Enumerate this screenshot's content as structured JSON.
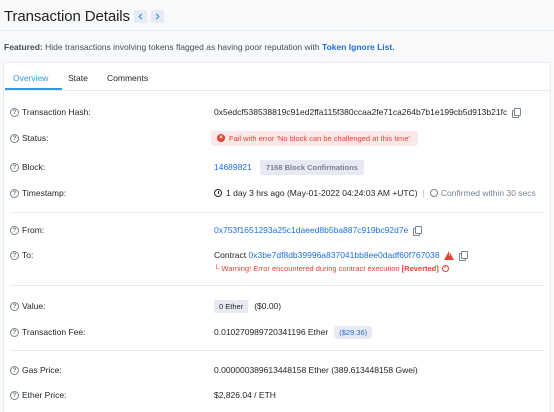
{
  "header": {
    "title": "Transaction Details",
    "prev_icon": "chevron-left-icon",
    "next_icon": "chevron-right-icon"
  },
  "featured": {
    "label": "Featured:",
    "text": "Hide transactions involving tokens flagged as having poor reputation with",
    "link": "Token Ignore List."
  },
  "tabs": [
    "Overview",
    "State",
    "Comments"
  ],
  "details": {
    "tx_hash": {
      "label": "Transaction Hash:",
      "value": "0x5edcf538538819c91ed2ffa115f380ccaa2fe71ca264b7b1e199cb5d913b21fc"
    },
    "status": {
      "label": "Status:",
      "value": "Fail with error 'No block can be challenged at this time'"
    },
    "block": {
      "label": "Block:",
      "value": "14689821",
      "confirmations": "7168 Block Confirmations"
    },
    "timestamp": {
      "label": "Timestamp:",
      "value": "1 day 3 hrs ago (May-01-2022 04:24:03 AM +UTC)",
      "separator": "|",
      "confirmed": "Confirmed within 30 secs"
    },
    "from": {
      "label": "From:",
      "value": "0x753f1651293a25c1daeed8b5ba887c919bc92d7e"
    },
    "to": {
      "label": "To:",
      "prefix": "Contract",
      "value": "0x3be7df8db39996a837041bb8ee0dadf60f767038",
      "warning_prefix": "└ Warning! Error encountered during contract execution",
      "warning_tag": "[Reverted]"
    },
    "value": {
      "label": "Value:",
      "ether": "0 Ether",
      "usd": "($0.00)"
    },
    "fee": {
      "label": "Transaction Fee:",
      "value": "0.010270989720341196 Ether",
      "usd": "($29.36)"
    },
    "gas_price": {
      "label": "Gas Price:",
      "value": "0.000000389613448158 Ether (389.613448158 Gwei)"
    },
    "ether_price": {
      "label": "Ether Price:",
      "value": "$2,826.04 / ETH"
    }
  },
  "colors": {
    "accent": "#3498db",
    "link": "#1e6fd9",
    "error": "#de4437",
    "error_bg": "#fde8e8",
    "muted": "#77838f"
  }
}
